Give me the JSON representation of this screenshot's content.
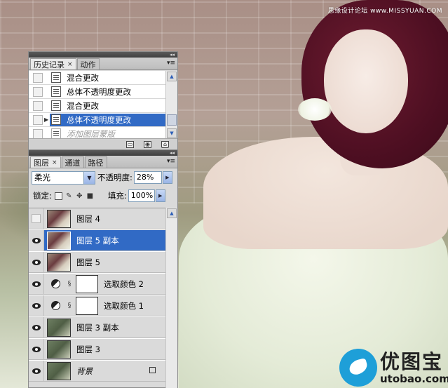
{
  "watermark": "思缘设计论坛 www.MISSYUAN.COM",
  "logo": {
    "cn": "优图宝",
    "en": "utobao.com"
  },
  "history_panel": {
    "tabs": [
      {
        "label": "历史记录",
        "active": true,
        "close": "×"
      },
      {
        "label": "动作",
        "active": false
      }
    ],
    "menu_icon": "panel-menu-icon",
    "items": [
      {
        "label": "混合更改",
        "selected": false,
        "dim": false
      },
      {
        "label": "总体不透明度更改",
        "selected": false,
        "dim": false
      },
      {
        "label": "混合更改",
        "selected": false,
        "dim": false
      },
      {
        "label": "总体不透明度更改",
        "selected": true,
        "dim": false
      },
      {
        "label": "添加图层蒙版",
        "selected": false,
        "dim": true
      }
    ],
    "footer_icons": [
      "new-document-icon",
      "camera-snapshot-icon",
      "trash-icon"
    ]
  },
  "layers_panel": {
    "tabs": [
      {
        "label": "图层",
        "active": true,
        "close": "×"
      },
      {
        "label": "通道",
        "active": false
      },
      {
        "label": "路径",
        "active": false
      }
    ],
    "blend_mode": "柔光",
    "opacity_label": "不透明度:",
    "opacity_value": "28%",
    "lock_label": "锁定:",
    "fill_label": "填充:",
    "fill_value": "100%",
    "layers": [
      {
        "name": "图层 4",
        "visible": false,
        "type": "image",
        "selected": false
      },
      {
        "name": "图层 5 副本",
        "visible": true,
        "type": "image",
        "selected": true
      },
      {
        "name": "图层 5",
        "visible": true,
        "type": "image",
        "selected": false
      },
      {
        "name": "选取颜色 2",
        "visible": true,
        "type": "adjustment",
        "selected": false
      },
      {
        "name": "选取颜色 1",
        "visible": true,
        "type": "adjustment",
        "selected": false
      },
      {
        "name": "图层 3 副本",
        "visible": true,
        "type": "image",
        "selected": false
      },
      {
        "name": "图层 3",
        "visible": true,
        "type": "image",
        "selected": false
      },
      {
        "name": "背景",
        "visible": true,
        "type": "image",
        "selected": false,
        "locked": true
      }
    ]
  },
  "colors": {
    "selection": "#316ac5",
    "panel_bg": "#dadada",
    "logo_blue": "#1e9fd8"
  }
}
